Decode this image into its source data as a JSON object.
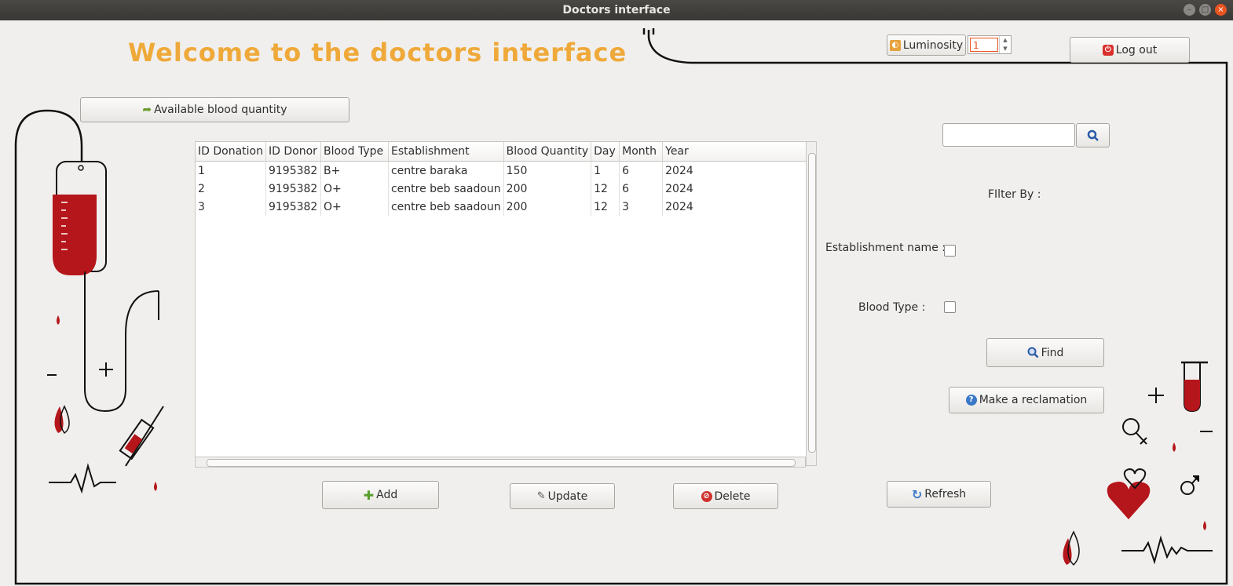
{
  "window": {
    "title": "Doctors interface"
  },
  "header": {
    "welcome": "Welcome to the doctors interface",
    "luminosity_label": "Luminosity",
    "luminosity_value": "1",
    "logout_label": "Log out"
  },
  "actions": {
    "available_blood_label": "Available blood quantity",
    "add_label": "Add",
    "update_label": "Update",
    "delete_label": "Delete",
    "refresh_label": "Refresh",
    "find_label": "Find",
    "reclamation_label": "Make a reclamation"
  },
  "filter": {
    "title": "FIlter By :",
    "establishment_label": "Establishment name :",
    "blood_type_label": "Blood Type :",
    "search_value": ""
  },
  "table": {
    "columns": [
      "ID Donation",
      "ID Donor",
      "Blood Type",
      "Establishment",
      "Blood Quantity",
      "Day",
      "Month",
      "Year"
    ],
    "rows": [
      [
        "1",
        "9195382",
        "B+",
        "centre baraka",
        "150",
        "1",
        "6",
        "2024"
      ],
      [
        "2",
        "9195382",
        "O+",
        "centre beb saadoun",
        "200",
        "12",
        "6",
        "2024"
      ],
      [
        "3",
        "9195382",
        "O+",
        "centre beb saadoun",
        "200",
        "12",
        "3",
        "2024"
      ]
    ]
  },
  "colors": {
    "accent": "#efa93a",
    "blood": "#b5161b",
    "window_close": "#e95420"
  },
  "icons": [
    "arrow-forward-icon",
    "search-icon",
    "power-icon",
    "plus-icon",
    "pencil-icon",
    "stop-icon",
    "refresh-icon",
    "help-icon"
  ]
}
